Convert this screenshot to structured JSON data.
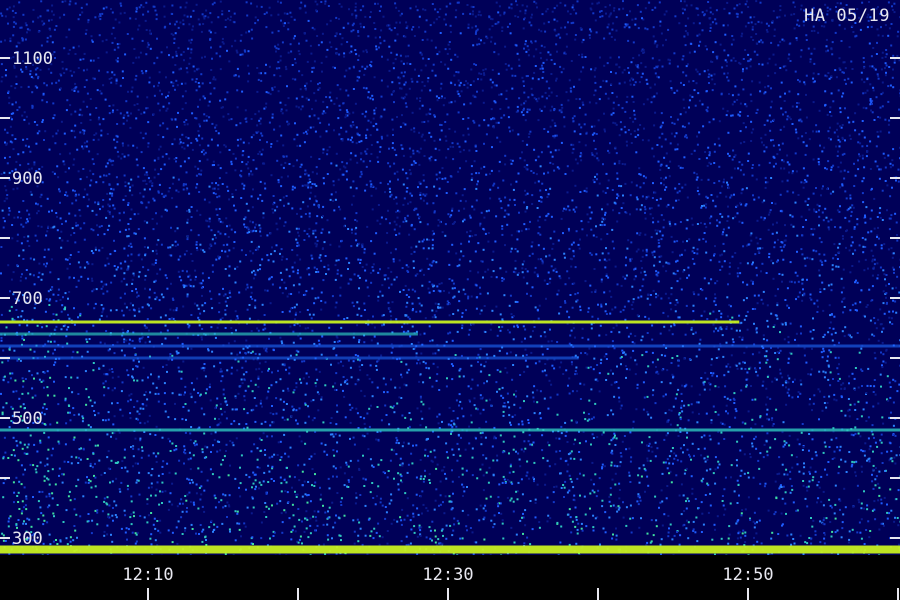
{
  "badge": "HA 05/19",
  "chart_data": {
    "type": "heatmap",
    "title": "",
    "xlabel": "",
    "ylabel": "",
    "y_ticks": [
      {
        "value": 1100,
        "label": "1100"
      },
      {
        "value": 900,
        "label": "900"
      },
      {
        "value": 700,
        "label": "700"
      },
      {
        "value": 500,
        "label": "500"
      },
      {
        "value": 300,
        "label": "300"
      }
    ],
    "x_ticks": [
      {
        "value": "12:10",
        "label": "12:10"
      },
      {
        "value": "12:30",
        "label": "12:30"
      },
      {
        "value": "12:50",
        "label": "12:50"
      }
    ],
    "ylim": [
      300,
      1100
    ],
    "xlim": [
      "12:04",
      "13:00"
    ],
    "bands": [
      {
        "freq": 660,
        "strength": 1.0,
        "t_end": "12:50"
      },
      {
        "freq": 640,
        "strength": 0.55,
        "t_end": "12:30"
      },
      {
        "freq": 620,
        "strength": 0.4,
        "t_end": "13:00"
      },
      {
        "freq": 600,
        "strength": 0.35,
        "t_end": "12:40"
      },
      {
        "freq": 480,
        "strength": 0.75,
        "t_end": "13:00"
      },
      {
        "freq": 285,
        "strength": 1.0,
        "t_end": "13:00"
      }
    ],
    "colors": {
      "low": "#0a0a5a",
      "mid": "#1e6cff",
      "high": "#2ec8c0",
      "peak": "#c8f020",
      "axis": "#e8e8f0",
      "background": "#000000"
    }
  }
}
